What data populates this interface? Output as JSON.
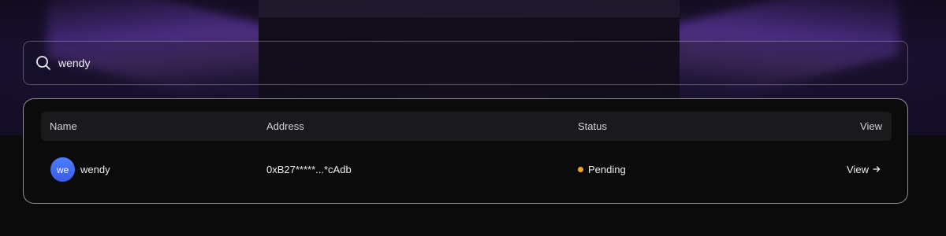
{
  "search": {
    "value": "wendy",
    "icon": "search-icon"
  },
  "table": {
    "headers": {
      "name": "Name",
      "address": "Address",
      "status": "Status",
      "view": "View"
    },
    "rows": [
      {
        "avatar_initials": "we",
        "name": "wendy",
        "address": "0xB27*****...*cAdb",
        "status": "Pending",
        "status_color": "#f5a524",
        "action": "View",
        "action_icon": "arrow-right-icon"
      }
    ]
  },
  "colors": {
    "accent": "#9456ff",
    "avatar": "#4068f0"
  }
}
